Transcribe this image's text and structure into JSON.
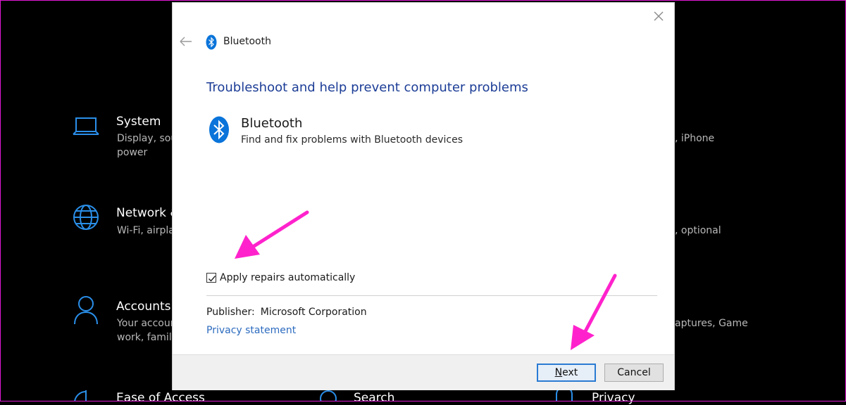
{
  "colors": {
    "accent": "#2a8ee8",
    "heading": "#1c3d96",
    "annotation_arrow": "#ff22cc",
    "link": "#2c6bbf"
  },
  "background": {
    "items": [
      {
        "icon": "laptop-icon",
        "title": "System",
        "desc_line1": "Display, sou",
        "desc_line2": "power"
      },
      {
        "icon": "globe-icon",
        "title": "Network &",
        "desc_line1": "Wi-Fi, airpla",
        "desc_line2": ""
      },
      {
        "icon": "person-icon",
        "title": "Accounts",
        "desc_line1": "Your accoun",
        "desc_line2": "work, family"
      },
      {
        "icon": "ease-of-access-icon",
        "title": "Ease of Access",
        "desc_line1": "",
        "desc_line2": ""
      },
      {
        "icon": "search-icon",
        "title": "Search",
        "desc_line1": "",
        "desc_line2": ""
      },
      {
        "icon": "privacy-icon",
        "title": "Privacy",
        "desc_line1": "",
        "desc_line2": ""
      }
    ],
    "right_fragments": [
      ", iPhone",
      ", optional",
      "aptures, Game"
    ]
  },
  "dialog": {
    "title": "Bluetooth",
    "heading": "Troubleshoot and help prevent computer problems",
    "tool": {
      "name": "Bluetooth",
      "description": "Find and fix problems with Bluetooth devices"
    },
    "checkbox": {
      "label": "Apply repairs automatically",
      "checked": true
    },
    "publisher_label": "Publisher:",
    "publisher_value": "Microsoft Corporation",
    "privacy_link": "Privacy statement",
    "buttons": {
      "next_first": "N",
      "next_rest": "ext",
      "cancel": "Cancel"
    }
  }
}
